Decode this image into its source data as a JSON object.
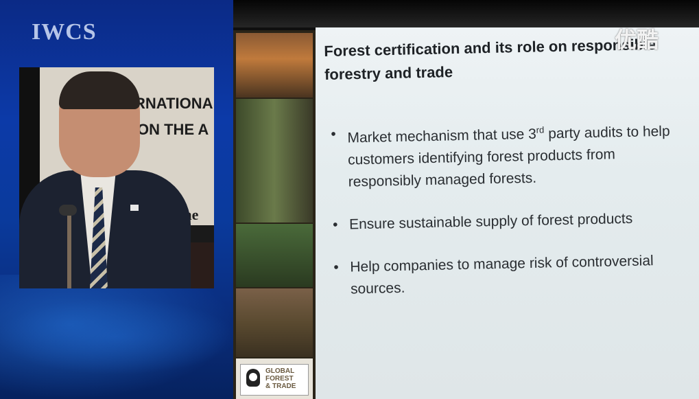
{
  "broadcast": {
    "logo_text": "IWCS",
    "watermark": "优酷"
  },
  "stage_banner": {
    "line1": "RNATIONA",
    "line2": "N ON THE A",
    "line3": "d: The"
  },
  "slide": {
    "title": "Forest certification and its role on responsible forestry and trade",
    "bullets": [
      {
        "text_before": "Market mechanism that use 3",
        "sup": "rd",
        "text_after": " party audits to help customers identifying forest products from responsibly managed forests."
      },
      {
        "text_before": "Ensure sustainable supply of forest products",
        "sup": "",
        "text_after": ""
      },
      {
        "text_before": "Help companies to manage risk of controversial sources.",
        "sup": "",
        "text_after": ""
      }
    ],
    "bullet_glyph": "•",
    "logo": {
      "line1": "GLOBAL",
      "line2": "FOREST",
      "line3": "& TRADE",
      "icon": "panda-icon"
    }
  },
  "colors": {
    "panel_blue": "#0c3aa8",
    "slide_bg": "#e4ecee",
    "title_text": "#1e2226"
  }
}
